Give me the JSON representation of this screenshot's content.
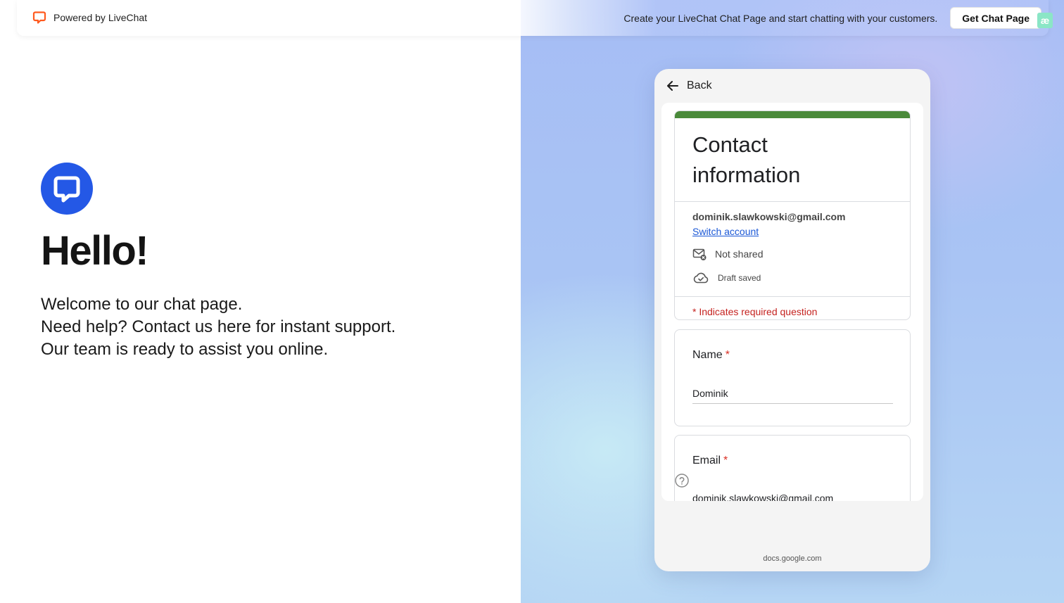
{
  "topbar": {
    "powered_label": "Powered by LiveChat",
    "promo_text": "Create your LiveChat Chat Page and start chatting with your customers.",
    "cta_label": "Get Chat Page",
    "badge_text": "æ"
  },
  "hero": {
    "heading": "Hello!",
    "lines": [
      "Welcome to our chat page.",
      "Need help? Contact us here for instant support.",
      "Our team is ready to assist you online."
    ]
  },
  "phone": {
    "back_label": "Back",
    "domain": "docs.google.com",
    "form": {
      "title_line1": "Contact",
      "title_line2": "information",
      "account_email": "dominik.slawkowski@gmail.com",
      "switch_label": "Switch account",
      "not_shared": "Not shared",
      "draft_saved": "Draft saved",
      "required_note": "* Indicates required question",
      "questions": [
        {
          "label": "Name",
          "required_mark": "*",
          "value": "Dominik"
        },
        {
          "label": "Email",
          "required_mark": "*",
          "value": "dominik.slawkowski@gmail.com"
        }
      ]
    }
  },
  "colors": {
    "livechat_orange": "#ff5a1f",
    "livechat_blue": "#2458e6",
    "form_accent_green": "#4a8a3a",
    "required_red": "#d93025",
    "link_blue": "#1a57d6"
  },
  "icons": {
    "topbar": "livechat-logo-icon",
    "hero": "livechat-logo-icon",
    "back": "arrow-left-icon",
    "not_shared": "mail-off-icon",
    "draft": "cloud-check-icon",
    "help": "help-circle-icon"
  }
}
